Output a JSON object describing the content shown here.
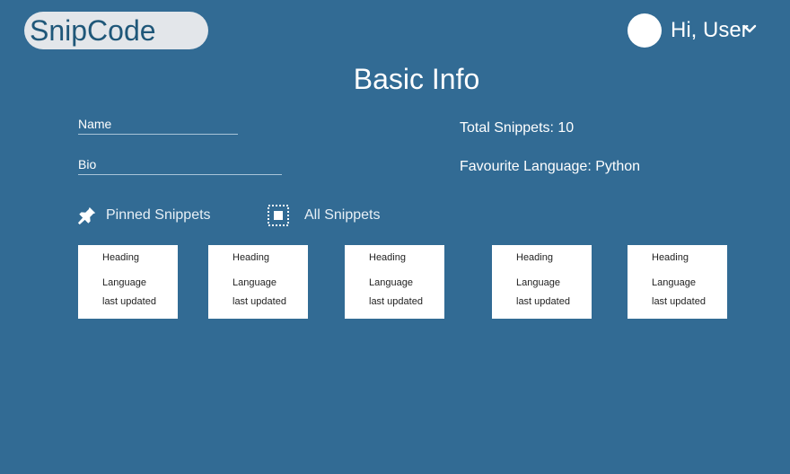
{
  "header": {
    "logo": "SnipCode",
    "greeting": "Hi, User"
  },
  "page": {
    "title": "Basic Info"
  },
  "profile": {
    "name_label": "Name",
    "bio_label": "Bio"
  },
  "stats": {
    "total_snippets": "Total Snippets: 10",
    "favourite_language": "Favourite Language: Python"
  },
  "tabs": [
    {
      "label": "Pinned Snippets",
      "icon": "pin-icon"
    },
    {
      "label": "All Snippets",
      "icon": "grid-select-icon"
    }
  ],
  "snippets": [
    {
      "heading": "Heading",
      "language": "Language",
      "updated": "last updated"
    },
    {
      "heading": "Heading",
      "language": "Language",
      "updated": "last updated"
    },
    {
      "heading": "Heading",
      "language": "Language",
      "updated": "last updated"
    },
    {
      "heading": "Heading",
      "language": "Language",
      "updated": "last updated"
    },
    {
      "heading": "Heading",
      "language": "Language",
      "updated": "last updated"
    }
  ],
  "colors": {
    "background": "#326b94",
    "logo_pill": "#e3e6ea",
    "logo_text": "#1f5779",
    "card": "#ffffff"
  }
}
